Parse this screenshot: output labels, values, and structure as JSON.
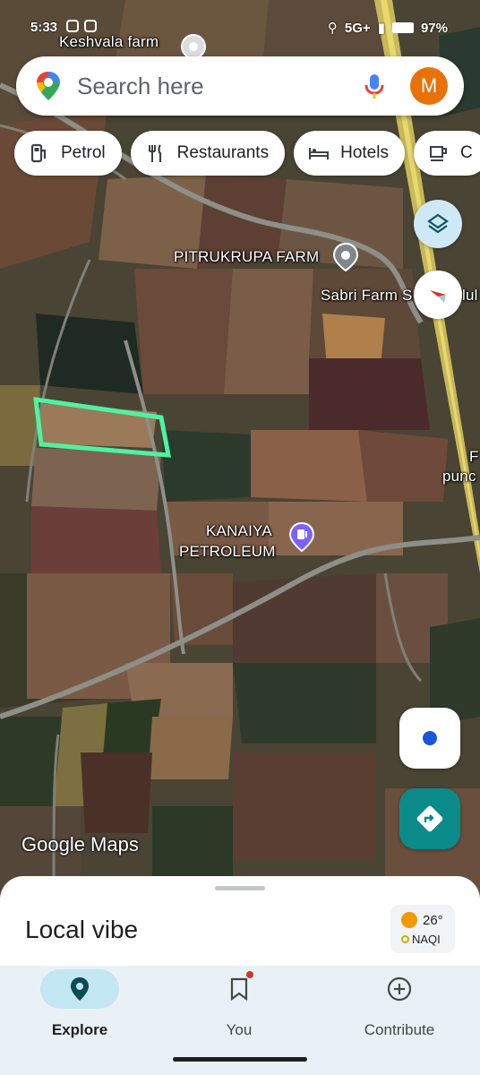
{
  "status_bar": {
    "time": "5:33",
    "network": "5G+",
    "battery": "97%"
  },
  "search": {
    "placeholder": "Search here",
    "avatar_letter": "M"
  },
  "chips": [
    {
      "label": "Petrol",
      "icon": "fuel-pump-icon"
    },
    {
      "label": "Restaurants",
      "icon": "fork-knife-icon"
    },
    {
      "label": "Hotels",
      "icon": "bed-icon"
    },
    {
      "label": "C",
      "icon": "cup-icon"
    }
  ],
  "map": {
    "labels": {
      "keshvala": "Keshvala farm",
      "pitrukrupa": "PITRUKRUPA FARM",
      "sabri": "Sabri Farm S",
      "sabri_tail": "lul",
      "kanaiya_1": "KANAIYA",
      "kanaiya_2": "PETROLEUM",
      "right_f": "F",
      "right_punc": "punc"
    },
    "watermark": "Google Maps",
    "highlight_color": "#4ff2a0"
  },
  "sheet": {
    "title": "Local vibe",
    "temperature": "26°",
    "air_quality": "NAQI"
  },
  "nav": {
    "explore": "Explore",
    "you": "You",
    "contribute": "Contribute"
  },
  "colors": {
    "accent": "#0b8a8a",
    "avatar": "#e8710a",
    "location_dot": "#1a56db"
  }
}
